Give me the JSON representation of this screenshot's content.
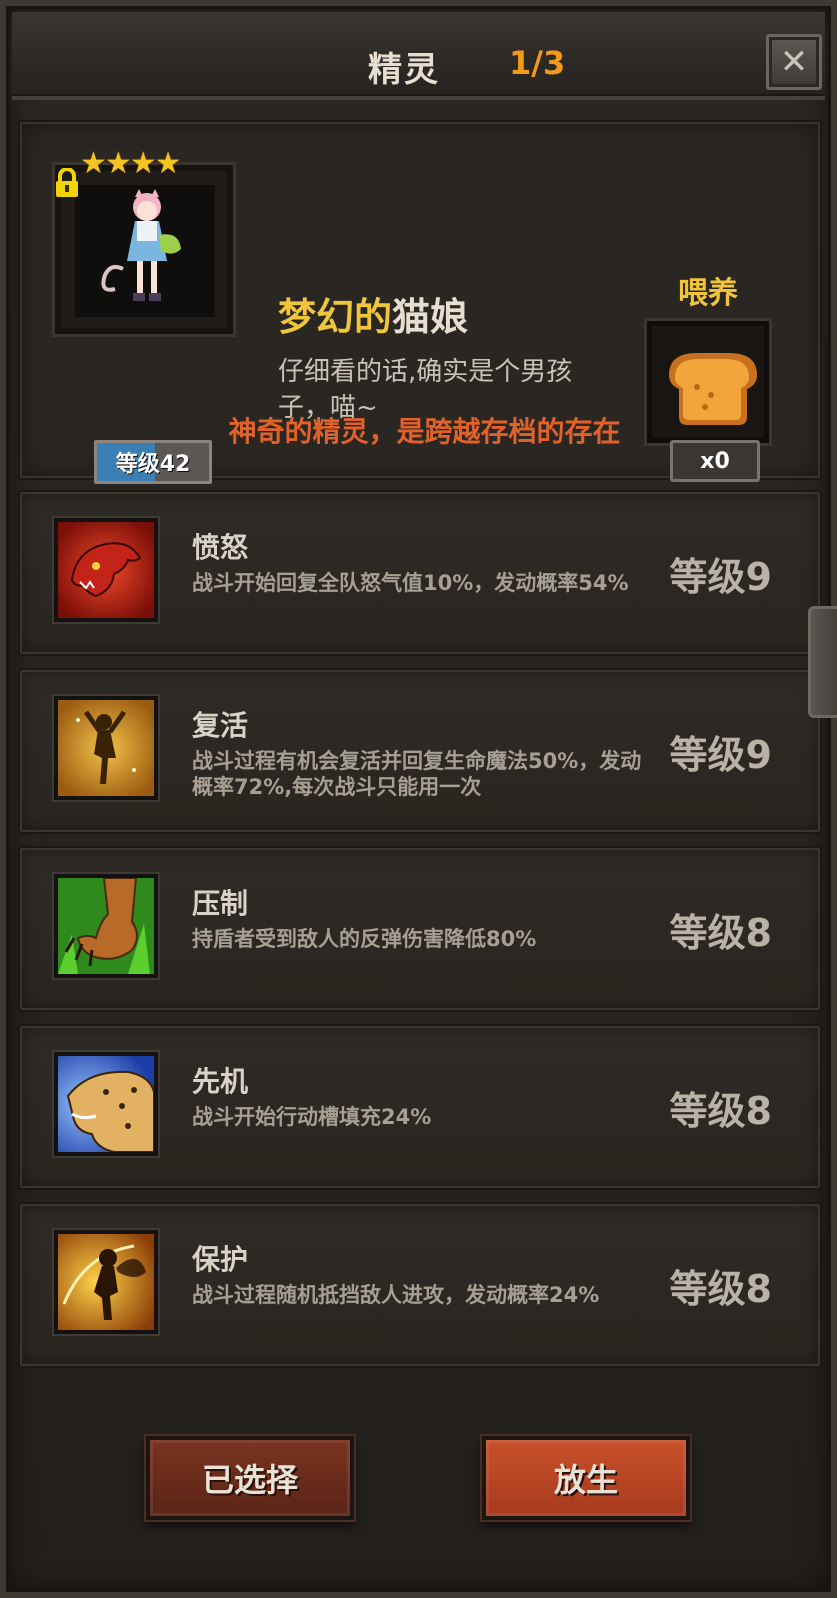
{
  "header": {
    "title": "精灵",
    "page": "1/3",
    "close_label": "✕"
  },
  "spirit": {
    "stars": "★★★★",
    "level_label": "等级42",
    "name_part1": "梦幻的",
    "name_part2": "猫娘",
    "description": "仔细看的话,确实是个男孩子，喵~",
    "tagline": "神奇的精灵，是跨越存档的存在"
  },
  "feed": {
    "label": "喂养",
    "count": "x0",
    "item_icon": "bread-icon"
  },
  "skills": [
    {
      "name": "愤怒",
      "desc": "战斗开始回复全队怒气值10%，发动概率54%",
      "level": "等级9",
      "icon": "panther-icon"
    },
    {
      "name": "复活",
      "desc": "战斗过程有机会复活并回复生命魔法50%，发动概率72%,每次战斗只能用一次",
      "level": "等级9",
      "icon": "revive-icon"
    },
    {
      "name": "压制",
      "desc": "持盾者受到敌人的反弹伤害降低80%",
      "level": "等级8",
      "icon": "claw-icon"
    },
    {
      "name": "先机",
      "desc": "战斗开始行动槽填充24%",
      "level": "等级8",
      "icon": "leopard-icon"
    },
    {
      "name": "保护",
      "desc": "战斗过程随机抵挡敌人进攻，发动概率24%",
      "level": "等级8",
      "icon": "fairy-icon"
    }
  ],
  "buttons": {
    "selected": "已选择",
    "release": "放生"
  },
  "colors": {
    "accent_orange": "#f29a1a",
    "name_gold": "#f0c53b",
    "tagline_orange": "#e0622a",
    "level_blue": "#3b7fb5"
  }
}
